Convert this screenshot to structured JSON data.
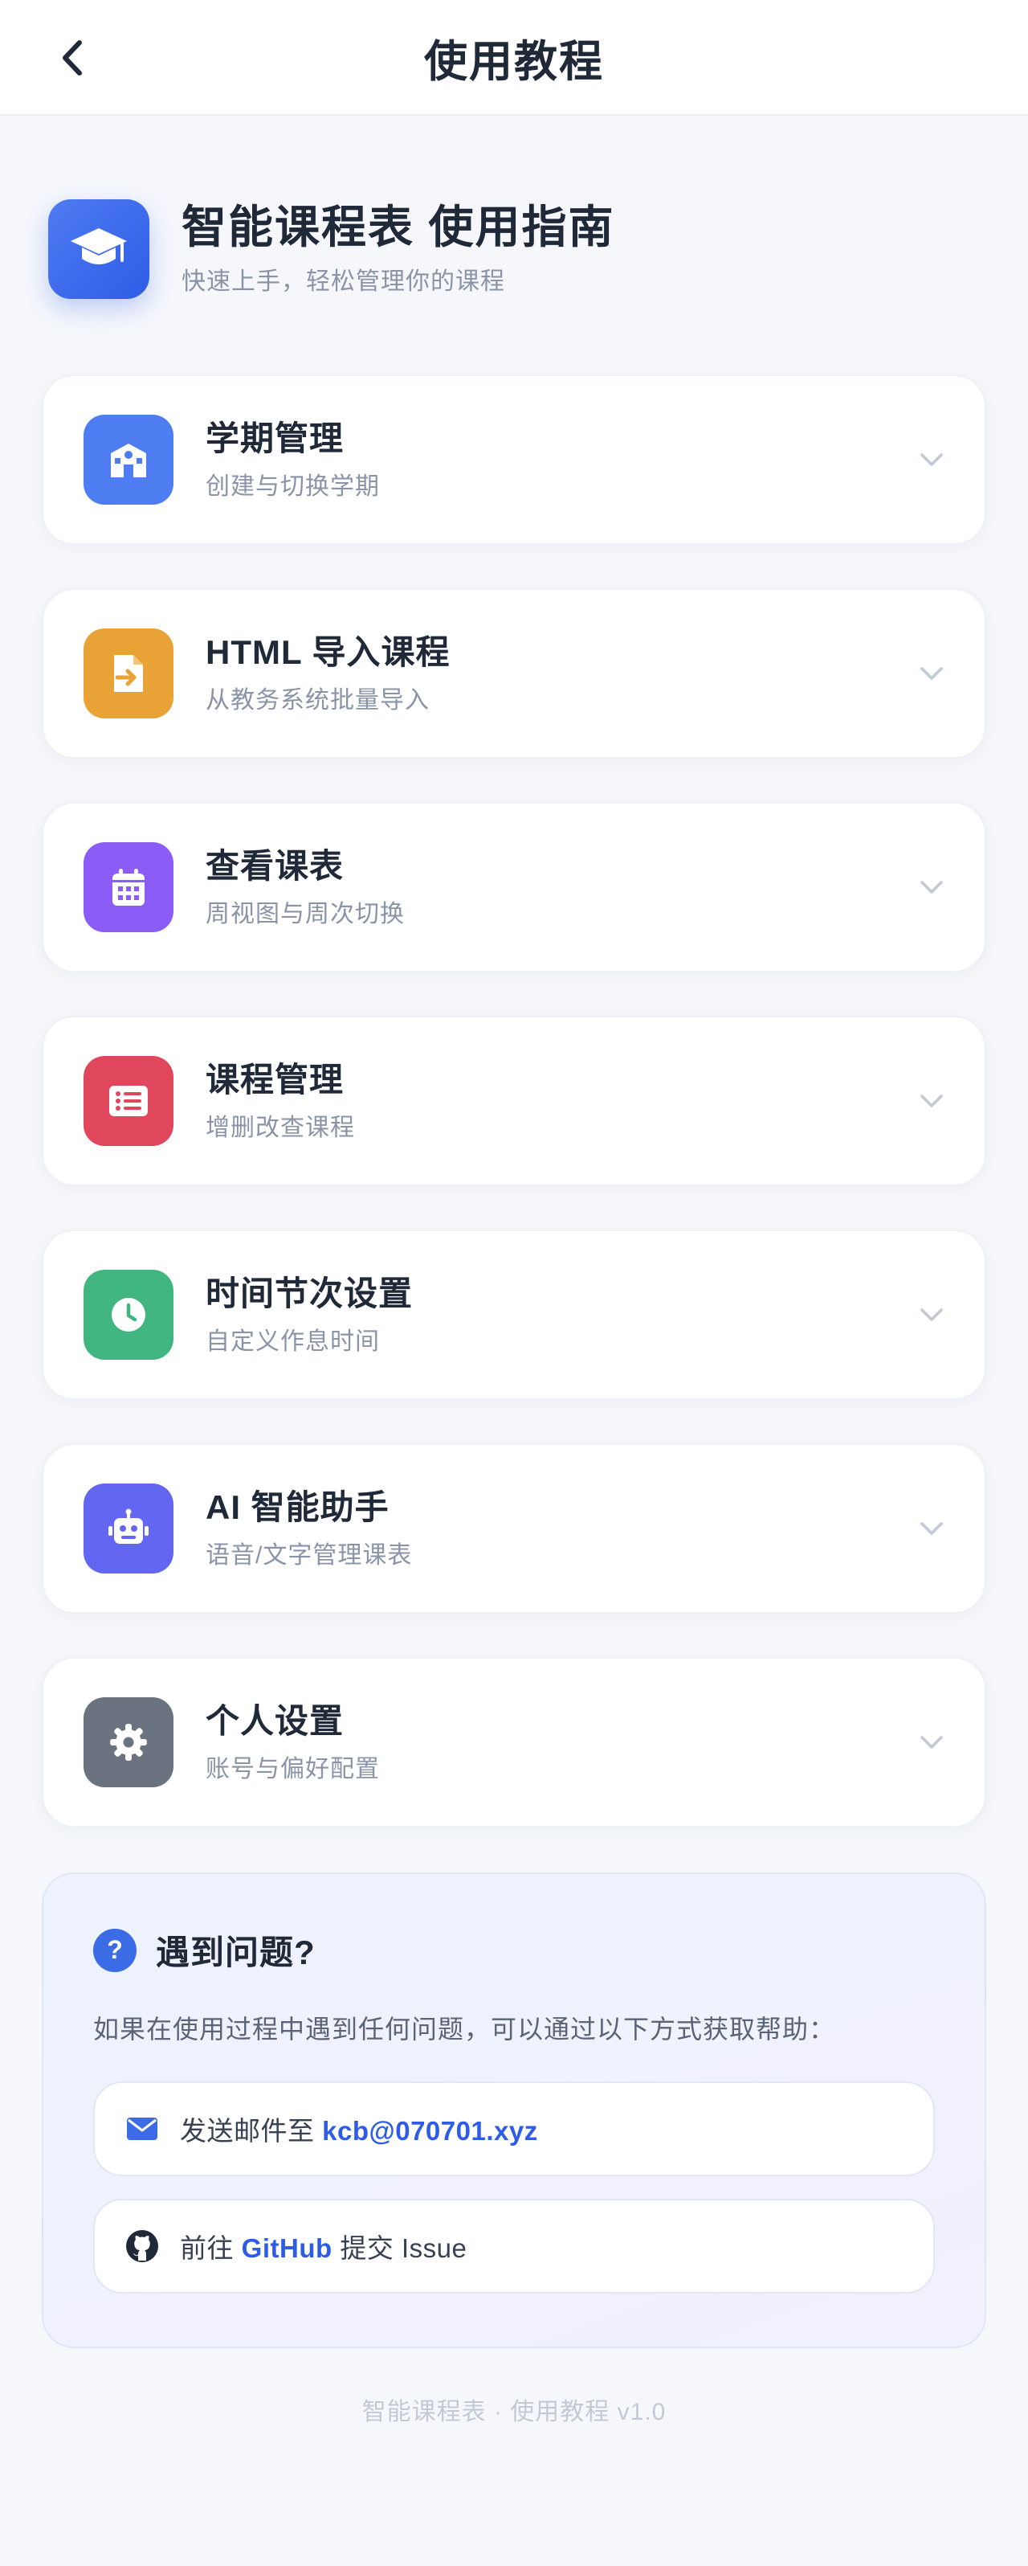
{
  "header": {
    "title": "使用教程"
  },
  "guide": {
    "title": "智能课程表 使用指南",
    "subtitle": "快速上手，轻松管理你的课程"
  },
  "sections": [
    {
      "title": "学期管理",
      "desc": "创建与切换学期",
      "icon": "school-icon",
      "color": "#4d7df1"
    },
    {
      "title": "HTML 导入课程",
      "desc": "从教务系统批量导入",
      "icon": "file-import-icon",
      "color": "#e8a236"
    },
    {
      "title": "查看课表",
      "desc": "周视图与周次切换",
      "icon": "calendar-icon",
      "color": "#8b5cf6"
    },
    {
      "title": "课程管理",
      "desc": "增删改查课程",
      "icon": "list-icon",
      "color": "#e0475d"
    },
    {
      "title": "时间节次设置",
      "desc": "自定义作息时间",
      "icon": "clock-icon",
      "color": "#41b57f"
    },
    {
      "title": "AI 智能助手",
      "desc": "语音/文字管理课表",
      "icon": "robot-icon",
      "color": "#6366f1"
    },
    {
      "title": "个人设置",
      "desc": "账号与偏好配置",
      "icon": "gear-icon",
      "color": "#6b7280"
    }
  ],
  "help": {
    "title": "遇到问题?",
    "text": "如果在使用过程中遇到任何问题，可以通过以下方式获取帮助：",
    "email": {
      "prefix": "发送邮件至 ",
      "link": "kcb@070701.xyz"
    },
    "github": {
      "prefix": "前往 ",
      "link": "GitHub",
      "suffix": " 提交 Issue"
    }
  },
  "footer": "智能课程表 · 使用教程 v1.0"
}
